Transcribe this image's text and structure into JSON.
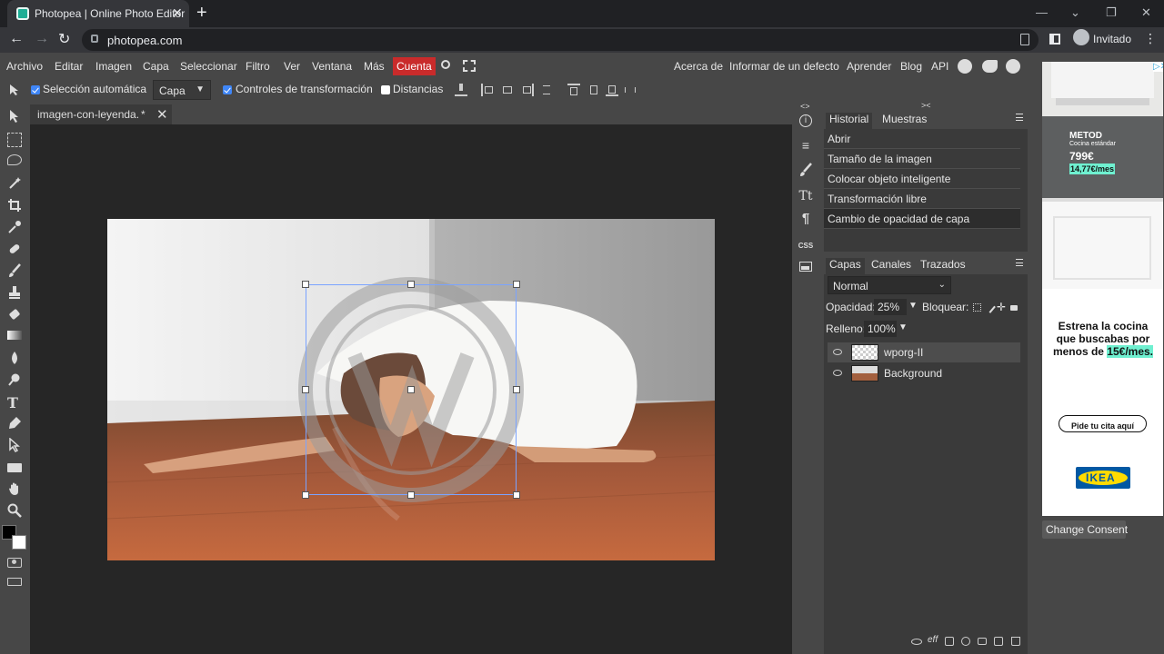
{
  "browser": {
    "tab_title": "Photopea | Online Photo Editor",
    "tab_close": "✕",
    "new_tab": "+",
    "url": "photopea.com",
    "profile_label": "Invitado",
    "win_min": "—",
    "win_max": "❐",
    "win_close": "✕"
  },
  "menu": {
    "items": [
      "Archivo",
      "Editar",
      "Imagen",
      "Capa",
      "Seleccionar",
      "Filtro",
      "Ver",
      "Ventana",
      "Más"
    ],
    "account": "Cuenta",
    "right_items": [
      "Acerca de",
      "Informar de un defecto",
      "Aprender",
      "Blog",
      "API"
    ]
  },
  "options": {
    "auto_select_label": "Selección automática",
    "auto_select_checked": true,
    "target_select": "Capa",
    "transform_controls_label": "Controles de transformación",
    "transform_controls_checked": true,
    "distances_label": "Distancias",
    "distances_checked": false
  },
  "document": {
    "tab_name": "imagen-con-leyenda.",
    "modified_marker": "*",
    "close": "✕"
  },
  "history": {
    "tabs": [
      "Historial",
      "Muestras"
    ],
    "active_tab": "Historial",
    "items": [
      "Abrir",
      "Tamaño de la imagen",
      "Colocar objeto inteligente",
      "Transformación libre",
      "Cambio de opacidad de capa"
    ],
    "selected_index": 4
  },
  "layers": {
    "tabs": [
      "Capas",
      "Canales",
      "Trazados"
    ],
    "active_tab": "Capas",
    "blend_mode": "Normal",
    "opacity_label": "Opacidad:",
    "opacity_value": "25%",
    "lock_label": "Bloquear:",
    "fill_label": "Relleno:",
    "fill_value": "100%",
    "items": [
      {
        "name": "wporg-II",
        "selected": true
      },
      {
        "name": "Background",
        "selected": false
      }
    ]
  },
  "side_icons": [
    "info-icon",
    "adjustments-icon",
    "brush-settings-icon",
    "character-icon",
    "paragraph-icon",
    "css-icon",
    "image-icon"
  ],
  "side_labels": {
    "css": "CSS",
    "character": "Tt",
    "paragraph": "¶"
  },
  "collapse_markers": {
    "left": "<>",
    "right": "><"
  },
  "ad": {
    "product": "METOD",
    "subtitle": "Cocina estándar",
    "price": "799€",
    "monthly": "14,77€/mes",
    "headline": "Estrena la cocina que buscabas por menos de",
    "highlight": "15€/mes.",
    "cta": "Pide tu cita aquí",
    "brand": "IKEA",
    "corner_badge": "▷✕"
  },
  "consent_button": "Change Consent",
  "colors": {
    "app_bg": "#474747",
    "workspace_bg": "#262626",
    "accent_account": "#c92b2b",
    "checkbox": "#3f86f7",
    "ikea_blue": "#0058a3",
    "ikea_yellow": "#ffdb00"
  }
}
